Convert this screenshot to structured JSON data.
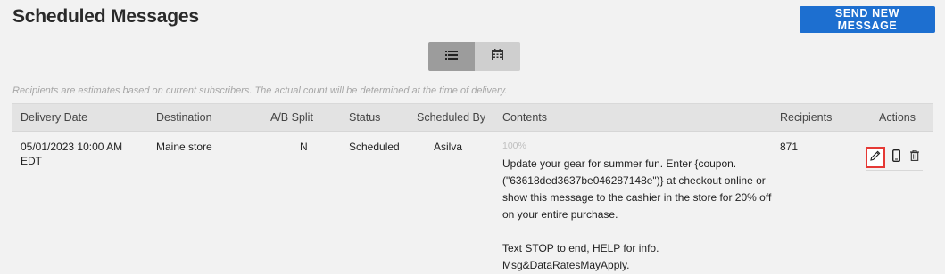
{
  "header": {
    "title": "Scheduled Messages",
    "send_button": "SEND NEW MESSAGE"
  },
  "view_toggle": {
    "options": [
      {
        "icon": "list-icon",
        "active": true
      },
      {
        "icon": "calendar-icon",
        "active": false
      }
    ]
  },
  "note": "Recipients are estimates based on current subscribers. The actual count will be determined at the time of delivery.",
  "table": {
    "columns": [
      "Delivery Date",
      "Destination",
      "A/B Split",
      "Status",
      "Scheduled By",
      "Contents",
      "Recipients",
      "Actions"
    ],
    "rows": [
      {
        "delivery_date": "05/01/2023 10:00 AM EDT",
        "destination": "Maine store",
        "ab_split": "N",
        "status": "Scheduled",
        "scheduled_by": "Asilva",
        "contents_percent": "100%",
        "contents_text": "Update your gear for summer fun. Enter {coupon.(\"63618ded3637be046287148e\")} at checkout online or show this message to the cashier in the store for 20% off on your entire purchase.",
        "contents_footer": "Text STOP to end, HELP for info. Msg&DataRatesMayApply.",
        "recipients": "871",
        "actions": [
          "pencil-icon",
          "phone-icon",
          "trash-icon"
        ]
      }
    ]
  },
  "colors": {
    "accent": "#1d6fd0",
    "highlight": "#e53935",
    "background": "#f2f2f2"
  }
}
